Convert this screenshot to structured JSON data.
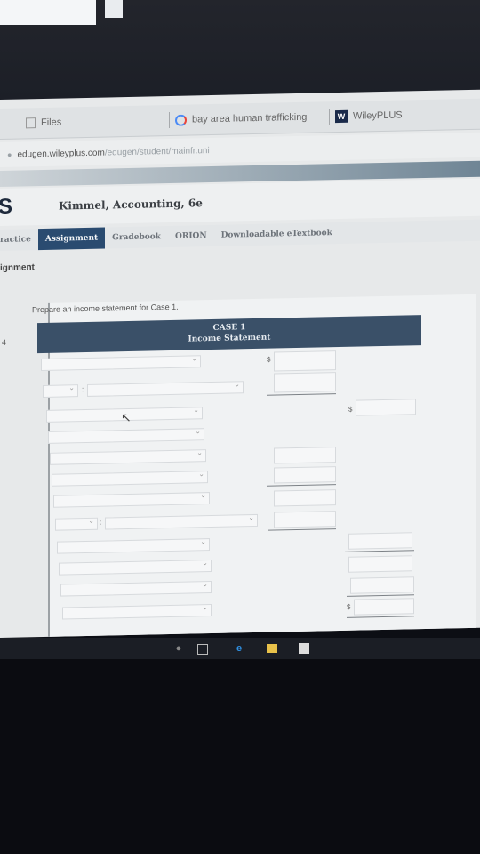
{
  "browser": {
    "tabs": [
      {
        "label": "Files",
        "icon": "file-icon"
      },
      {
        "label": "bay area human trafficking",
        "icon": "google-icon",
        "glyph": "G"
      },
      {
        "label": "WileyPLUS",
        "icon": "wiley-icon",
        "glyph": "W"
      }
    ],
    "url_domain": "edugen.wileyplus.com",
    "url_path": "/edugen/student/mainfr.uni"
  },
  "app": {
    "logo_text": "S",
    "book_title": "Kimmel, Accounting, 6e"
  },
  "nav": {
    "items": [
      {
        "label": "ractice"
      },
      {
        "label": "Assignment",
        "active": true
      },
      {
        "label": "Gradebook"
      },
      {
        "label": "ORION"
      },
      {
        "label": "Downloadable eTextbook"
      }
    ]
  },
  "page": {
    "heading": "ignment",
    "row_number": "4",
    "instruction": "Prepare an income statement for Case 1."
  },
  "statement": {
    "header_line1": "CASE 1",
    "header_line2": "Income Statement",
    "currency_symbol": "$",
    "colon": ":"
  },
  "colors": {
    "accent": "#2a4b70",
    "header_bg": "#3a5068"
  }
}
